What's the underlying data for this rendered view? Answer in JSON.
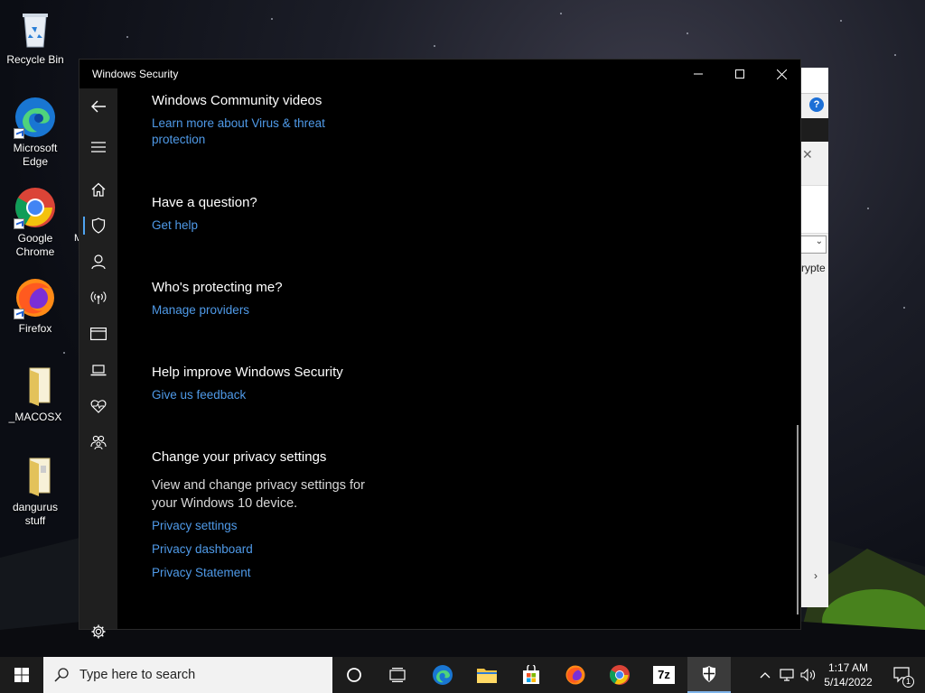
{
  "desktop": {
    "icons": [
      {
        "label": "Recycle Bin",
        "icon": "recycle-bin-icon"
      },
      {
        "label": "Microsoft Edge",
        "icon": "edge-icon"
      },
      {
        "label": "Google Chrome",
        "icon": "chrome-icon"
      },
      {
        "label": "Firefox",
        "icon": "firefox-icon"
      },
      {
        "label": "_MACOSX",
        "icon": "folder-icon"
      },
      {
        "label": "dangurus stuff",
        "icon": "folder-icon"
      }
    ],
    "stray_letter": "M"
  },
  "background_window": {
    "help_label": "?",
    "text_fragment": "rypte"
  },
  "window": {
    "title": "Windows Security",
    "sections": [
      {
        "heading": "Windows Community videos",
        "links": [
          "Learn more about Virus & threat protection"
        ]
      },
      {
        "heading": "Have a question?",
        "links": [
          "Get help"
        ]
      },
      {
        "heading": "Who's protecting me?",
        "links": [
          "Manage providers"
        ]
      },
      {
        "heading": "Help improve Windows Security",
        "links": [
          "Give us feedback"
        ]
      },
      {
        "heading": "Change your privacy settings",
        "body": "View and change privacy settings for your Windows 10 device.",
        "links": [
          "Privacy settings",
          "Privacy dashboard",
          "Privacy Statement"
        ]
      }
    ],
    "nav": [
      "back-icon",
      "menu-icon",
      "home-icon",
      "shield-icon",
      "account-icon",
      "wireless-icon",
      "app-browser-icon",
      "device-security-icon",
      "health-heart-icon",
      "family-icon",
      "settings-icon"
    ]
  },
  "taskbar": {
    "search_placeholder": "Type here to search",
    "time": "1:17 AM",
    "date": "5/14/2022",
    "notification_count": "1",
    "sevenzip_label": "7z"
  },
  "colors": {
    "link": "#4f9ae8",
    "accent": "#4fa3f0"
  }
}
